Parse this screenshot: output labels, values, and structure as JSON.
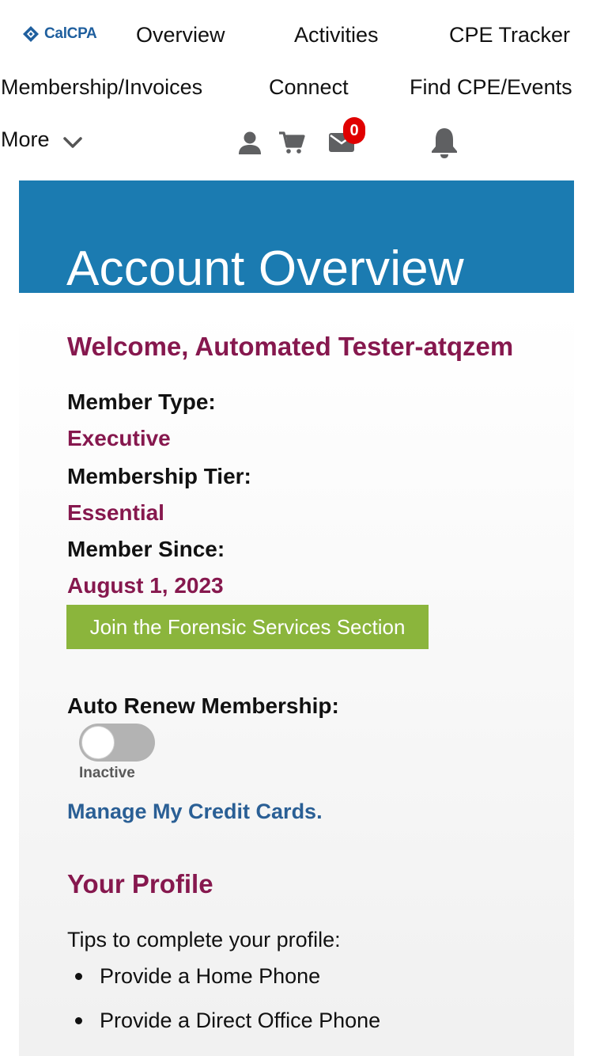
{
  "nav": {
    "logo_text": "CalCPA",
    "items": [
      "Overview",
      "Activities",
      "CPE Tracker",
      "Membership/Invoices",
      "Connect",
      "Find CPE/Events"
    ],
    "more_label": "More",
    "mail_count": "0",
    "icons": [
      "user-icon",
      "cart-icon",
      "mail-icon",
      "bell-icon",
      "chevron-down-icon"
    ]
  },
  "banner": {
    "title": "Account Overview"
  },
  "account": {
    "welcome": "Welcome, Automated Tester-atqzem",
    "member_type_label": "Member Type:",
    "member_type": "Executive",
    "tier_label": "Membership Tier:",
    "tier": "Essential",
    "since_label": "Member Since:",
    "since": "August 1, 2023",
    "join_button": "Join the Forensic Services Section",
    "auto_renew_label": "Auto Renew Membership:",
    "auto_renew_status": "Inactive",
    "manage_cards_link": "Manage My Credit Cards."
  },
  "profile": {
    "heading": "Your Profile",
    "tips_intro": "Tips to complete your profile:",
    "tips": [
      "Provide a Home Phone",
      "Provide a Direct Office Phone"
    ]
  },
  "colors": {
    "banner": "#1b7bb1",
    "accent_purple": "#86184e",
    "button_green": "#8bb53c",
    "link_blue": "#2a5f95",
    "badge_red": "#e00000"
  }
}
